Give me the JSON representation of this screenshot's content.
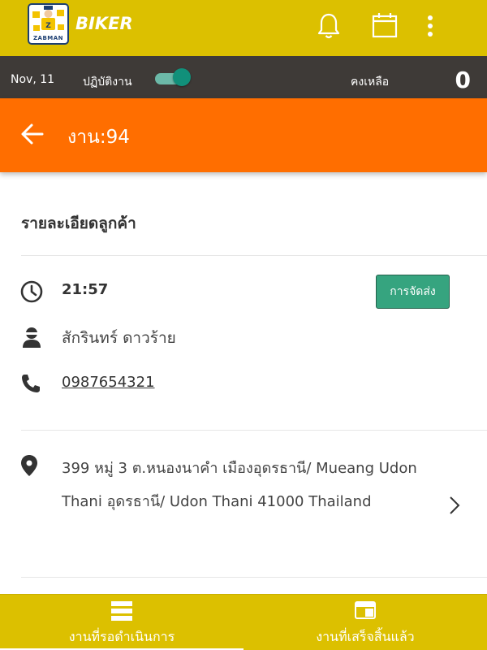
{
  "header": {
    "logo_text": "ZABMAN",
    "brand": "BIKER",
    "icons": [
      "bell-icon",
      "calendar-icon",
      "more-vertical-icon"
    ]
  },
  "status": {
    "date": "Nov, 11",
    "duty_label": "ปฏิบัติงาน",
    "duty_on": true,
    "remaining_label": "คงเหลือ",
    "remaining_count": "0"
  },
  "job": {
    "title": "งาน:94"
  },
  "customer": {
    "section_title": "รายละเอียดลูกค้า",
    "time": "21:57",
    "delivery_button": "การจัดส่ง",
    "name": "สักรินทร์ ดาวร้าย",
    "phone": "0987654321",
    "address": "399 หมู่ 3 ต.หนองนาคำ เมืองอุดรธานี/ Mueang Udon Thani อุดรธานี/ Udon Thani 41000 Thailand"
  },
  "tabs": [
    {
      "label": "งานที่รอดำเนินการ",
      "icon": "list-icon",
      "active": true
    },
    {
      "label": "งานที่เสร็จสิ้นแล้ว",
      "icon": "completed-icon",
      "active": false
    }
  ],
  "colors": {
    "appbar": "#dcc000",
    "statusbar": "#3e3a37",
    "orange": "#ff6e00",
    "toggle": "#11907a",
    "button": "#36a47f"
  }
}
